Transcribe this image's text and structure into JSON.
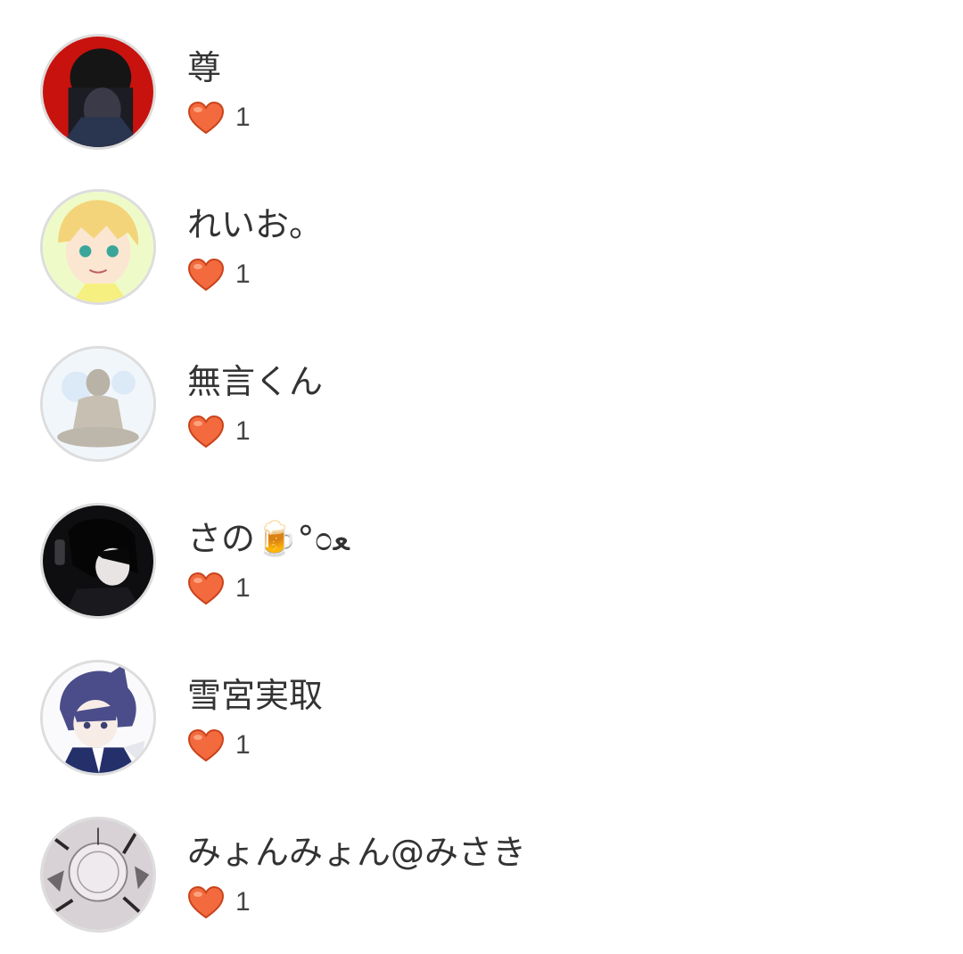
{
  "users": [
    {
      "name": "尊",
      "likes": "1",
      "avatar": "dark-hand-portrait"
    },
    {
      "name": "れいお。",
      "likes": "1",
      "avatar": "blonde-anime-boy"
    },
    {
      "name": "無言くん",
      "likes": "1",
      "avatar": "buddha-statue"
    },
    {
      "name": "さの🍺°೦ﻌ",
      "likes": "1",
      "avatar": "dark-hair-boy"
    },
    {
      "name": "雪宮実取",
      "likes": "1",
      "avatar": "purple-cat-ear-boy"
    },
    {
      "name": "みょんみょん@みさき",
      "likes": "1",
      "avatar": "monochrome-artwork"
    }
  ],
  "colors": {
    "heart": "#f26a3d",
    "heart_outline": "#c9431c",
    "text": "#333333",
    "avatar_border": "#dddddd"
  },
  "icons": {
    "like": "heart-icon"
  }
}
